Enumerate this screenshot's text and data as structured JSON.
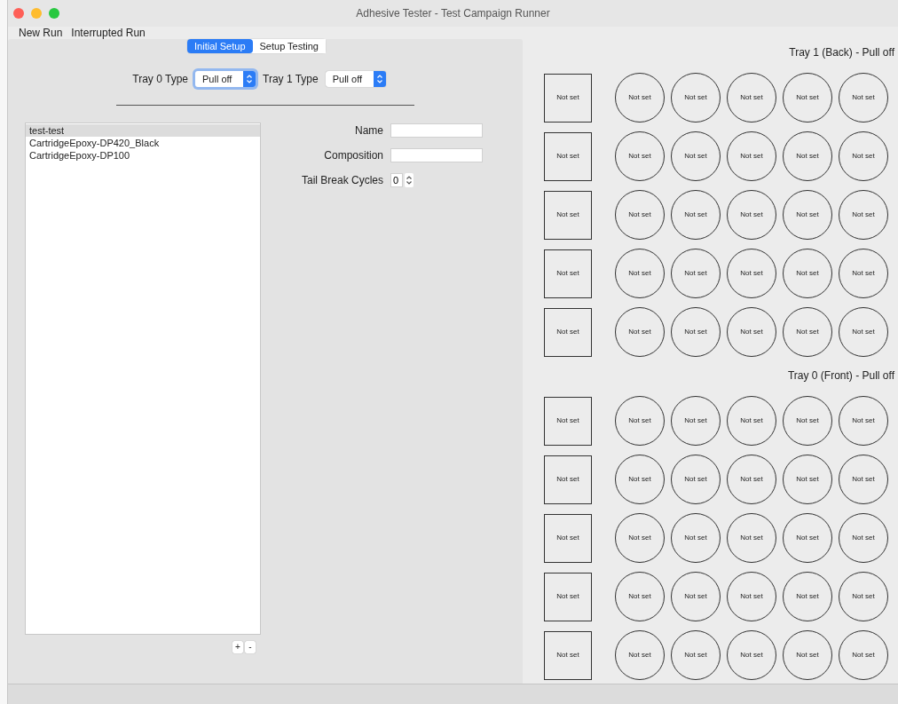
{
  "window": {
    "title": "Adhesive Tester - Test Campaign Runner"
  },
  "menu": [
    "New Run",
    "Interrupted Run"
  ],
  "tabs": [
    {
      "label": "Initial Setup",
      "selected": true
    },
    {
      "label": "Setup Testing",
      "selected": false
    }
  ],
  "tray_types": [
    {
      "label": "Tray 0 Type",
      "value": "Pull off",
      "focused": true
    },
    {
      "label": "Tray 1 Type",
      "value": "Pull off",
      "focused": false
    }
  ],
  "materials": [
    {
      "label": "test-test",
      "selected": true
    },
    {
      "label": "CartridgeEpoxy-DP420_Black",
      "selected": false
    },
    {
      "label": "CartridgeEpoxy-DP100",
      "selected": false
    }
  ],
  "list_buttons": [
    "+",
    "-"
  ],
  "form": {
    "name_label": "Name",
    "composition_label": "Composition",
    "tail_break_label": "Tail Break Cycles",
    "tail_break_value": "0"
  },
  "trays": [
    {
      "title": "Tray 1 (Back) - Pull off",
      "rows": [
        {
          "label": "Not set",
          "wells": [
            "Not set",
            "Not set",
            "Not set",
            "Not set",
            "Not set"
          ]
        },
        {
          "label": "Not set",
          "wells": [
            "Not set",
            "Not set",
            "Not set",
            "Not set",
            "Not set"
          ]
        },
        {
          "label": "Not set",
          "wells": [
            "Not set",
            "Not set",
            "Not set",
            "Not set",
            "Not set"
          ]
        },
        {
          "label": "Not set",
          "wells": [
            "Not set",
            "Not set",
            "Not set",
            "Not set",
            "Not set"
          ]
        },
        {
          "label": "Not set",
          "wells": [
            "Not set",
            "Not set",
            "Not set",
            "Not set",
            "Not set"
          ]
        }
      ]
    },
    {
      "title": "Tray 0 (Front) - Pull off",
      "rows": [
        {
          "label": "Not set",
          "wells": [
            "Not set",
            "Not set",
            "Not set",
            "Not set",
            "Not set"
          ]
        },
        {
          "label": "Not set",
          "wells": [
            "Not set",
            "Not set",
            "Not set",
            "Not set",
            "Not set"
          ]
        },
        {
          "label": "Not set",
          "wells": [
            "Not set",
            "Not set",
            "Not set",
            "Not set",
            "Not set"
          ]
        },
        {
          "label": "Not set",
          "wells": [
            "Not set",
            "Not set",
            "Not set",
            "Not set",
            "Not set"
          ]
        },
        {
          "label": "Not set",
          "wells": [
            "Not set",
            "Not set",
            "Not set",
            "Not set",
            "Not set"
          ]
        }
      ]
    }
  ]
}
